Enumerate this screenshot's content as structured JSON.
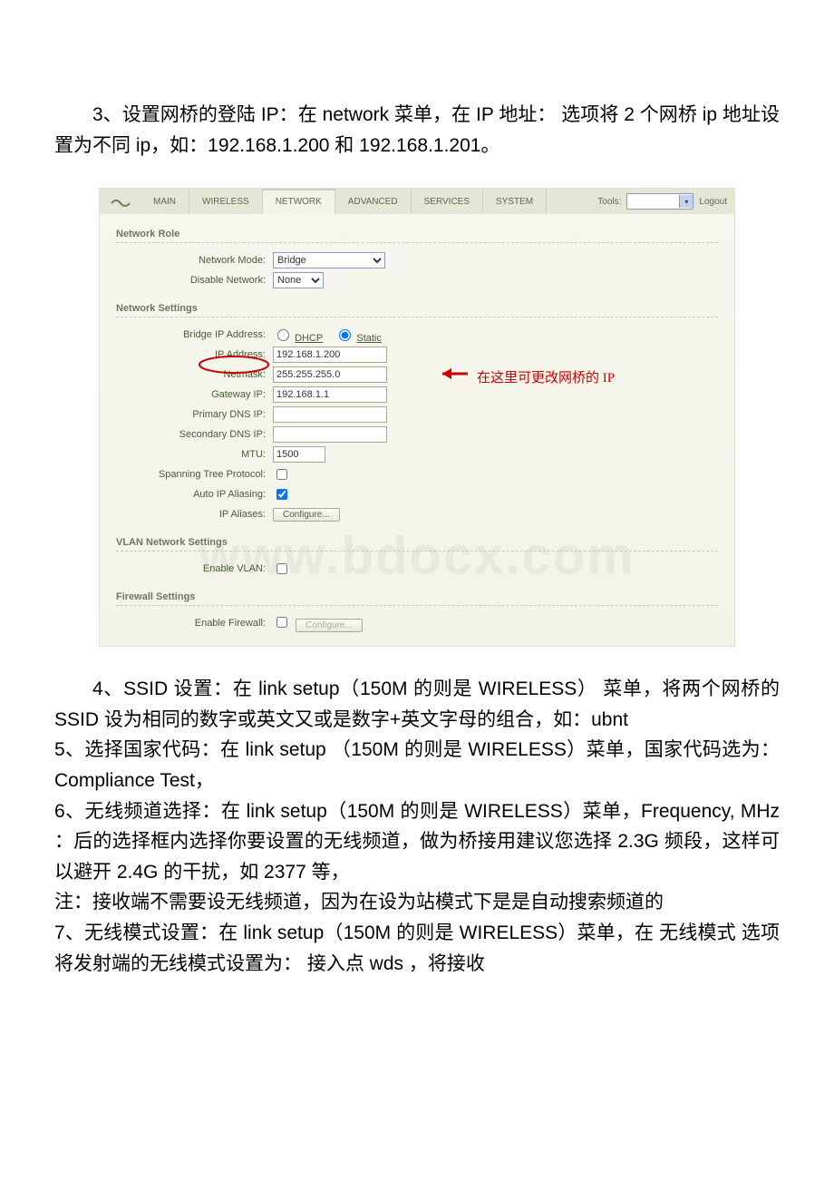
{
  "intro_text": "3、设置网桥的登陆 IP：在 network 菜单，在 IP 地址： 选项将 2 个网桥 ip 地址设置为不同 ip，如：192.168.1.200 和 192.168.1.201。",
  "tabs": {
    "main": "MAIN",
    "wireless": "WIRELESS",
    "network": "NETWORK",
    "advanced": "ADVANCED",
    "services": "SERVICES",
    "system": "SYSTEM"
  },
  "tools_label": "Tools:",
  "logout": "Logout",
  "section_network_role": "Network Role",
  "network_mode_label": "Network Mode:",
  "network_mode_value": "Bridge",
  "disable_network_label": "Disable Network:",
  "disable_network_value": "None",
  "section_network_settings": "Network Settings",
  "bridge_ip_label": "Bridge IP Address:",
  "radio_dhcp": "DHCP",
  "radio_static": "Static",
  "ip_label": "IP Address:",
  "ip_value": "192.168.1.200",
  "netmask_label": "Netmask:",
  "netmask_value": "255.255.255.0",
  "gateway_label": "Gateway IP:",
  "gateway_value": "192.168.1.1",
  "pdns_label": "Primary DNS IP:",
  "pdns_value": "",
  "sdns_label": "Secondary DNS IP:",
  "sdns_value": "",
  "mtu_label": "MTU:",
  "mtu_value": "1500",
  "stp_label": "Spanning Tree Protocol:",
  "autoip_label": "Auto IP Aliasing:",
  "ipaliases_label": "IP Aliases:",
  "configure_btn": "Configure...",
  "section_vlan": "VLAN Network Settings",
  "enable_vlan_label": "Enable VLAN:",
  "section_firewall": "Firewall Settings",
  "enable_firewall_label": "Enable Firewall:",
  "watermark": "www.bdocx.com",
  "callout_text": "在这里可更改网桥的 IP",
  "para2": "4、SSID 设置：在 link setup（150M 的则是 WIRELESS） 菜单，将两个网桥的 SSID 设为相同的数字或英文又或是数字+英文字母的组合，如：ubnt",
  "para3": "5、选择国家代码：在 link setup （150M 的则是 WIRELESS）菜单，国家代码选为：Compliance Test，",
  "para4": "6、无线频道选择：在 link setup（150M 的则是 WIRELESS）菜单，Frequency, MHz ：后的选择框内选择你要设置的无线频道，做为桥接用建议您选择 2.3G 频段，这样可以避开 2.4G 的干扰，如 2377 等，",
  "para5": "注：接收端不需要设无线频道，因为在设为站模式下是是自动搜索频道的",
  "para6": "7、无线模式设置：在 link setup（150M 的则是 WIRELESS）菜单，在 无线模式 选项将发射端的无线模式设置为： 接入点 wds ，将接收"
}
